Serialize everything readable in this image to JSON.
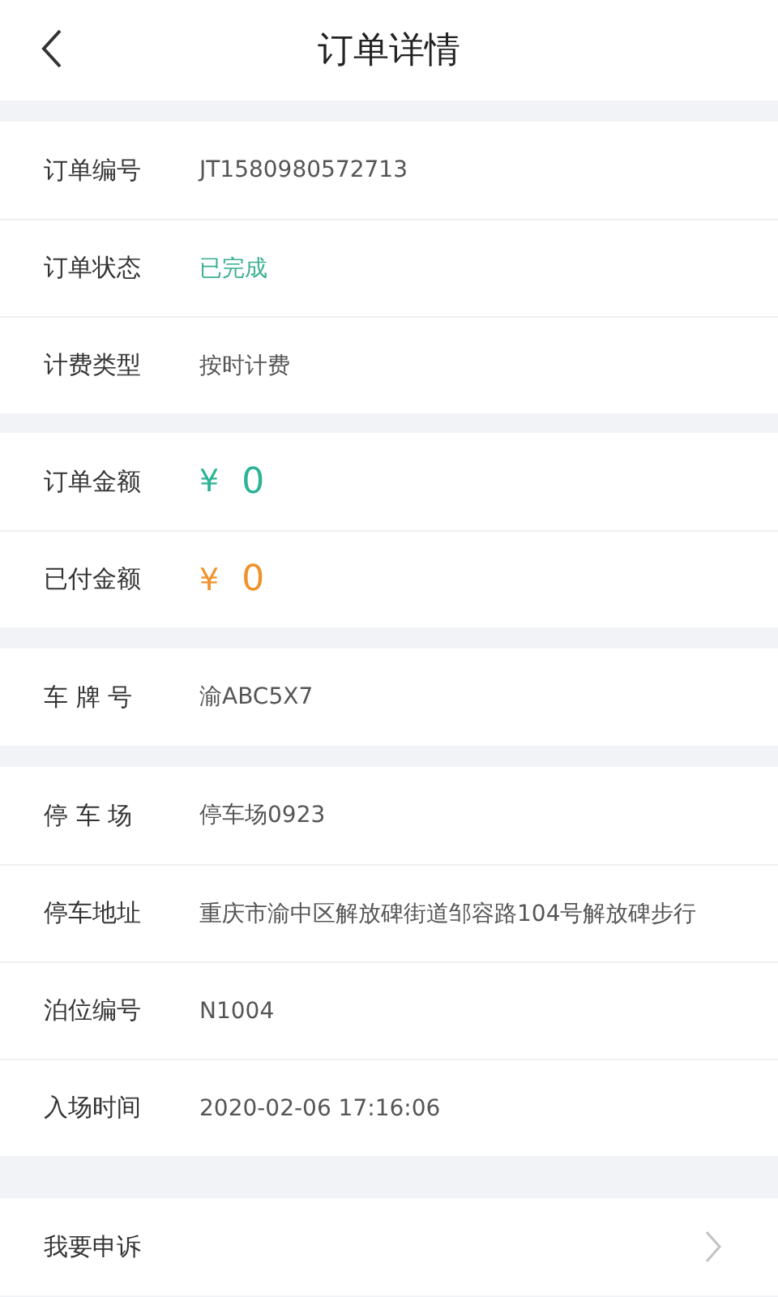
{
  "header": {
    "title": "订单详情"
  },
  "sections": [
    {
      "rows": [
        {
          "label": "订单编号",
          "kind": "text",
          "value": "JT1580980572713"
        },
        {
          "label": "订单状态",
          "kind": "status",
          "value": "已完成",
          "color": "#3bb08f"
        },
        {
          "label": "计费类型",
          "kind": "text",
          "value": "按时计费"
        }
      ]
    },
    {
      "rows": [
        {
          "label": "订单金额",
          "kind": "amount",
          "symbol": "¥",
          "value": "0",
          "color": "#2bb393"
        },
        {
          "label": "已付金额",
          "kind": "amount",
          "symbol": "¥",
          "value": "0",
          "color": "#f0922c"
        }
      ]
    },
    {
      "rows": [
        {
          "label": "车 牌 号",
          "kind": "text",
          "value": "渝ABC5X7"
        }
      ]
    },
    {
      "rows": [
        {
          "label": "停 车 场",
          "kind": "text",
          "value": "停车场0923"
        },
        {
          "label": "停车地址",
          "kind": "text",
          "value": "重庆市渝中区解放碑街道邹容路104号解放碑步行"
        },
        {
          "label": "泊位编号",
          "kind": "text",
          "value": "N1004"
        },
        {
          "label": "入场时间",
          "kind": "text",
          "value": "2020-02-06 17:16:06"
        }
      ]
    },
    {
      "rows": [
        {
          "label": "我要申诉",
          "kind": "link"
        }
      ]
    }
  ]
}
